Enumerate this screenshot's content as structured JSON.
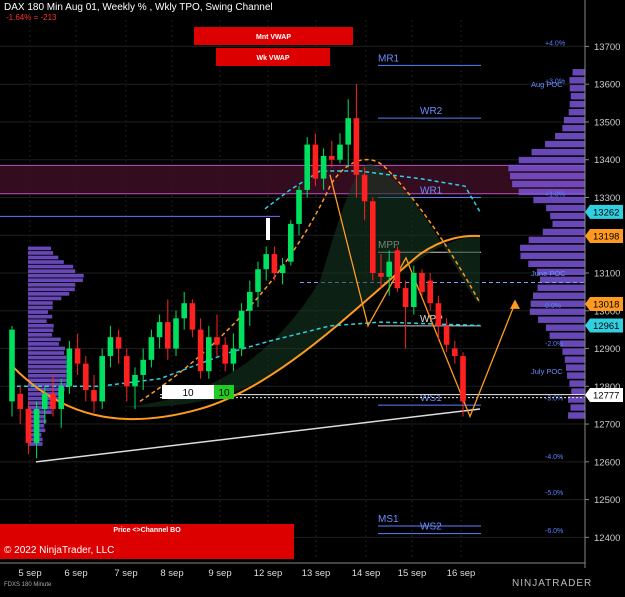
{
  "header": {
    "title": "DAX 180 Min Aug 01, Weekly % , Wkly TPO, Swing Channel",
    "change": "-1.64% = -213"
  },
  "footer": {
    "instrument": "FDXS 180 Minute",
    "copyright": "© 2022 NinjaTrader, LLC",
    "brand": "NINJATRADER"
  },
  "colors": {
    "background": "#000000",
    "up": "#00e060",
    "down": "#ff2020",
    "grid": "#1e1e1e",
    "profile": "#7a55d6",
    "vwap_orange": "#ff9a20",
    "cyan": "#30d0e0",
    "level_blue": "#5a80ff"
  },
  "chart_data": {
    "type": "candlestick",
    "xlabel": "",
    "ylabel": "",
    "ylim": [
      12340,
      13770
    ],
    "grid": true,
    "y_ticks": [
      12400,
      12500,
      12600,
      12700,
      12800,
      12900,
      13000,
      13100,
      13200,
      13300,
      13400,
      13500,
      13600,
      13700
    ],
    "x_ticks": [
      "5 sep",
      "6 sep",
      "7 sep",
      "8 sep",
      "9 sep",
      "12 sep",
      "13 sep",
      "14 sep",
      "15 sep",
      "16 sep"
    ],
    "candles": [
      {
        "o": 12760,
        "h": 12960,
        "l": 12720,
        "c": 12950
      },
      {
        "o": 12780,
        "h": 12800,
        "l": 12700,
        "c": 12740
      },
      {
        "o": 12740,
        "h": 12760,
        "l": 12620,
        "c": 12650
      },
      {
        "o": 12650,
        "h": 12760,
        "l": 12610,
        "c": 12740
      },
      {
        "o": 12740,
        "h": 12800,
        "l": 12700,
        "c": 12780
      },
      {
        "o": 12780,
        "h": 12830,
        "l": 12720,
        "c": 12740
      },
      {
        "o": 12740,
        "h": 12820,
        "l": 12690,
        "c": 12800
      },
      {
        "o": 12800,
        "h": 12920,
        "l": 12780,
        "c": 12900
      },
      {
        "o": 12900,
        "h": 12940,
        "l": 12830,
        "c": 12860
      },
      {
        "o": 12860,
        "h": 12880,
        "l": 12760,
        "c": 12790
      },
      {
        "o": 12790,
        "h": 12830,
        "l": 12730,
        "c": 12760
      },
      {
        "o": 12760,
        "h": 12900,
        "l": 12740,
        "c": 12880
      },
      {
        "o": 12880,
        "h": 12960,
        "l": 12850,
        "c": 12930
      },
      {
        "o": 12930,
        "h": 12950,
        "l": 12860,
        "c": 12900
      },
      {
        "o": 12880,
        "h": 12900,
        "l": 12760,
        "c": 12800
      },
      {
        "o": 12800,
        "h": 12850,
        "l": 12740,
        "c": 12830
      },
      {
        "o": 12830,
        "h": 12900,
        "l": 12790,
        "c": 12870
      },
      {
        "o": 12870,
        "h": 12950,
        "l": 12850,
        "c": 12930
      },
      {
        "o": 12930,
        "h": 12990,
        "l": 12900,
        "c": 12970
      },
      {
        "o": 12970,
        "h": 13030,
        "l": 12870,
        "c": 12900
      },
      {
        "o": 12900,
        "h": 13000,
        "l": 12880,
        "c": 12980
      },
      {
        "o": 12980,
        "h": 13050,
        "l": 12950,
        "c": 13020
      },
      {
        "o": 13020,
        "h": 13030,
        "l": 12930,
        "c": 12950
      },
      {
        "o": 12950,
        "h": 12980,
        "l": 12820,
        "c": 12840
      },
      {
        "o": 12840,
        "h": 12960,
        "l": 12820,
        "c": 12930
      },
      {
        "o": 12930,
        "h": 12990,
        "l": 12880,
        "c": 12910
      },
      {
        "o": 12910,
        "h": 12930,
        "l": 12840,
        "c": 12860
      },
      {
        "o": 12860,
        "h": 12940,
        "l": 12840,
        "c": 12900
      },
      {
        "o": 12900,
        "h": 13020,
        "l": 12880,
        "c": 13000
      },
      {
        "o": 13000,
        "h": 13080,
        "l": 12960,
        "c": 13050
      },
      {
        "o": 13050,
        "h": 13130,
        "l": 13010,
        "c": 13110
      },
      {
        "o": 13110,
        "h": 13170,
        "l": 13080,
        "c": 13150
      },
      {
        "o": 13150,
        "h": 13170,
        "l": 13080,
        "c": 13100
      },
      {
        "o": 13100,
        "h": 13140,
        "l": 13070,
        "c": 13120
      },
      {
        "o": 13130,
        "h": 13240,
        "l": 13120,
        "c": 13230
      },
      {
        "o": 13230,
        "h": 13330,
        "l": 13200,
        "c": 13320
      },
      {
        "o": 13320,
        "h": 13460,
        "l": 13300,
        "c": 13440
      },
      {
        "o": 13440,
        "h": 13470,
        "l": 13330,
        "c": 13350
      },
      {
        "o": 13350,
        "h": 13430,
        "l": 13320,
        "c": 13410
      },
      {
        "o": 13410,
        "h": 13450,
        "l": 13380,
        "c": 13400
      },
      {
        "o": 13400,
        "h": 13470,
        "l": 13390,
        "c": 13440
      },
      {
        "o": 13440,
        "h": 13560,
        "l": 13380,
        "c": 13510
      },
      {
        "o": 13510,
        "h": 13600,
        "l": 13300,
        "c": 13360
      },
      {
        "o": 13360,
        "h": 13380,
        "l": 13240,
        "c": 13290
      },
      {
        "o": 13290,
        "h": 13300,
        "l": 13080,
        "c": 13100
      },
      {
        "o": 13100,
        "h": 13150,
        "l": 13060,
        "c": 13090
      },
      {
        "o": 13090,
        "h": 13160,
        "l": 13040,
        "c": 13130
      },
      {
        "o": 13160,
        "h": 13170,
        "l": 13050,
        "c": 13060
      },
      {
        "o": 13060,
        "h": 13080,
        "l": 12900,
        "c": 13010
      },
      {
        "o": 13010,
        "h": 13120,
        "l": 12990,
        "c": 13100
      },
      {
        "o": 13100,
        "h": 13110,
        "l": 13040,
        "c": 13050
      },
      {
        "o": 13080,
        "h": 13100,
        "l": 13000,
        "c": 13020
      },
      {
        "o": 13020,
        "h": 13040,
        "l": 12920,
        "c": 12960
      },
      {
        "o": 12960,
        "h": 12980,
        "l": 12890,
        "c": 12910
      },
      {
        "o": 12900,
        "h": 12920,
        "l": 12860,
        "c": 12880
      },
      {
        "o": 12880,
        "h": 12890,
        "l": 12720,
        "c": 12760
      }
    ],
    "price_labels": [
      {
        "price": 13262,
        "label": "13262",
        "color": "#30d0e0"
      },
      {
        "price": 13198,
        "label": "13198",
        "color": "#ff9a20"
      },
      {
        "price": 13018,
        "label": "13018",
        "color": "#ff9a20"
      },
      {
        "price": 12961,
        "label": "12961",
        "color": "#30d0e0"
      },
      {
        "price": 12777,
        "label": "12777",
        "color": "#ffffff"
      }
    ],
    "percent_levels": [
      {
        "price": 13710,
        "label": "+4.0%"
      },
      {
        "price": 13610,
        "label": "+3.0%"
      },
      {
        "price": 13310,
        "label": "+1.0%"
      },
      {
        "price": 13015,
        "label": "0.0%"
      },
      {
        "price": 12915,
        "label": "-2.0%"
      },
      {
        "price": 12420,
        "label": "-6.0%"
      }
    ],
    "percent_levels_red": [
      {
        "price": 12615,
        "label": "-4.0%"
      },
      {
        "price": 12520,
        "label": "-5.0%"
      },
      {
        "price": 12770,
        "label": "-3.0%"
      }
    ],
    "poc_labels": [
      {
        "price": 13600,
        "label": "Aug POC"
      },
      {
        "price": 13100,
        "label": "June POC"
      },
      {
        "price": 12840,
        "label": "July POC"
      }
    ],
    "pivots": [
      {
        "price": 13650,
        "label": "MR1"
      },
      {
        "price": 13510,
        "label": "WR2"
      },
      {
        "price": 13300,
        "label": "WR1"
      },
      {
        "price": 13155,
        "label": "MPP"
      },
      {
        "price": 12960,
        "label": "WPP"
      },
      {
        "price": 12750,
        "label": "WS1"
      },
      {
        "price": 12430,
        "label": "MS1"
      },
      {
        "price": 12410,
        "label": "WS2"
      }
    ],
    "banners": {
      "mnt_vwap": "Mnt VWAP",
      "wk_vwap": "Wk VWAP",
      "channel": "Price <>Channel BO"
    },
    "boxes": {
      "left": "10",
      "right": "10"
    }
  }
}
